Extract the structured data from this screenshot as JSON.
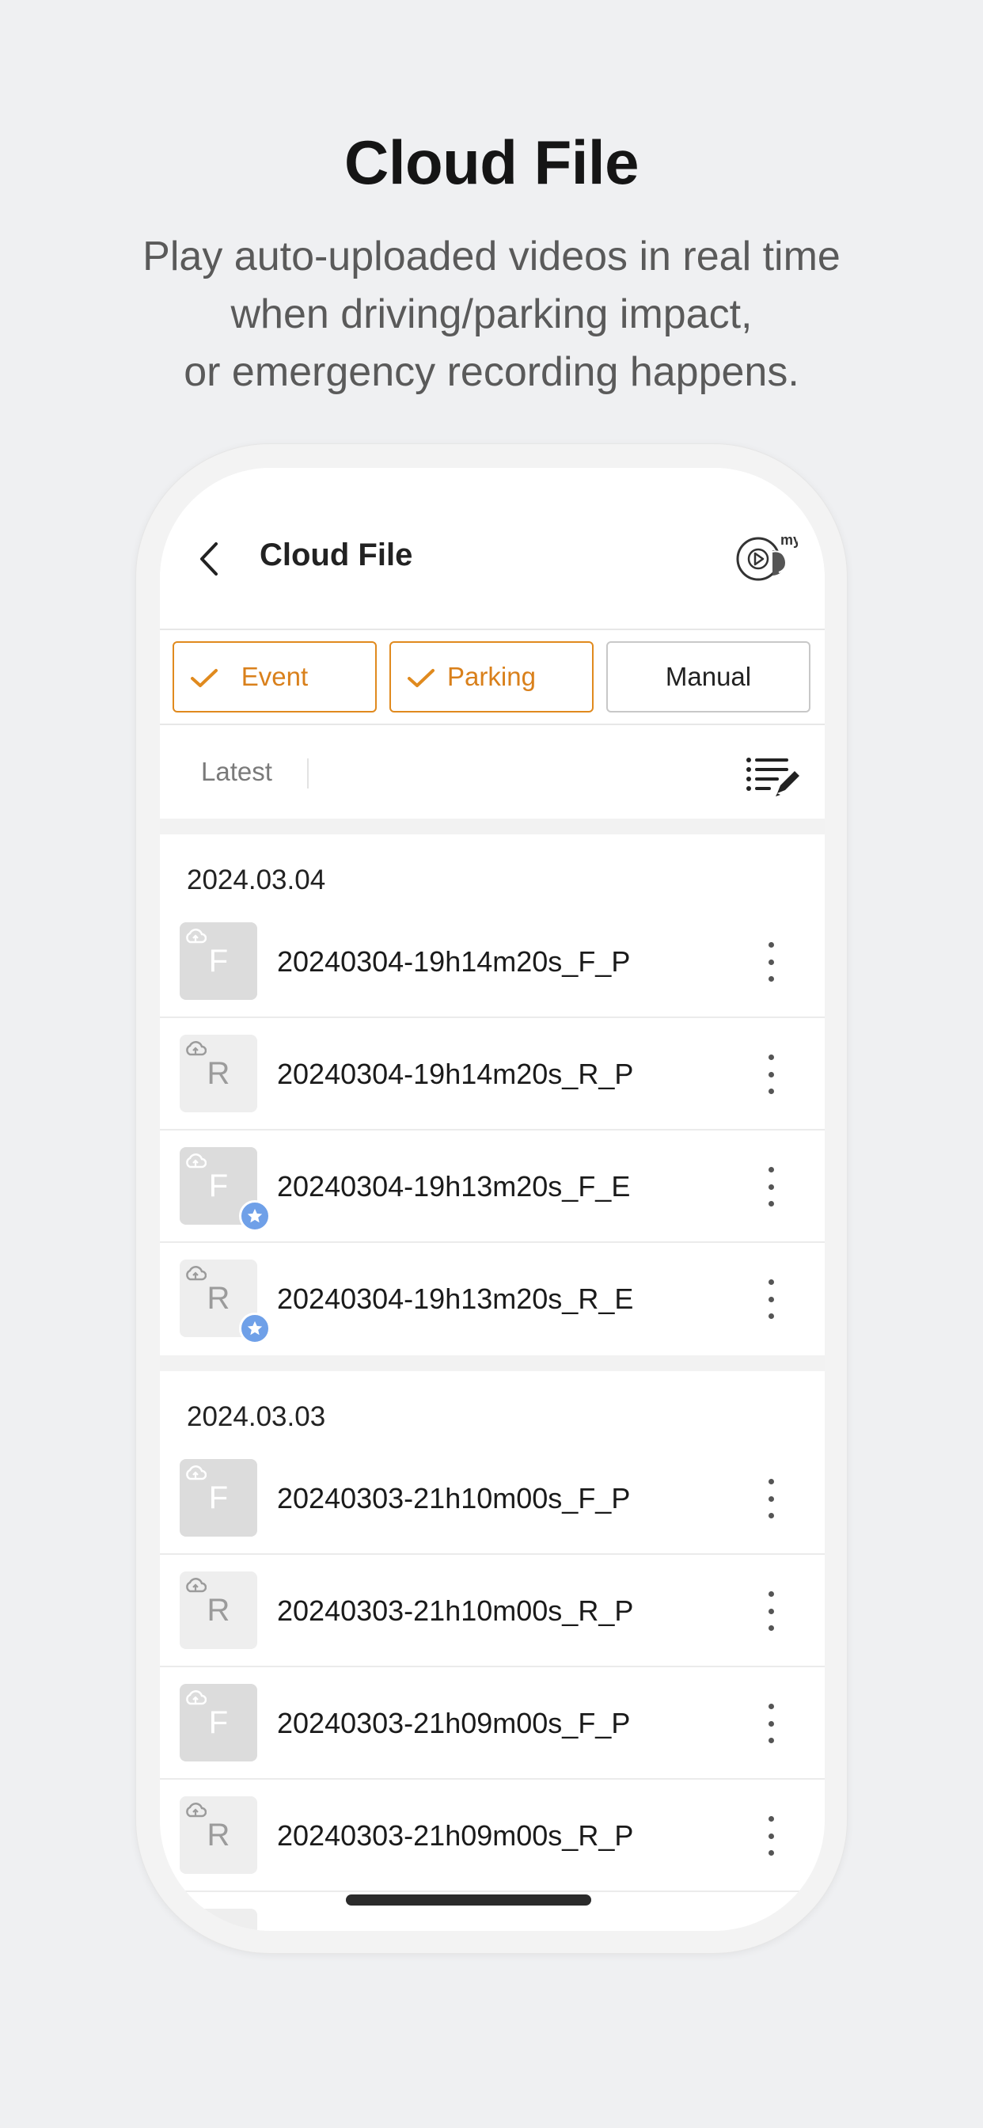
{
  "promo": {
    "title": "Cloud File",
    "subtitle_lines": [
      "Play auto-uploaded videos in real time",
      "when driving/parking impact,",
      "or emergency recording happens."
    ]
  },
  "app": {
    "title": "Cloud File",
    "back_icon": "chevron-left-icon",
    "logo_badge": "my"
  },
  "filters": [
    {
      "label": "Event",
      "selected": true
    },
    {
      "label": "Parking",
      "selected": true
    },
    {
      "label": "Manual",
      "selected": false
    }
  ],
  "sort": {
    "label": "Latest"
  },
  "colors": {
    "accent": "#e08a1e",
    "star": "#6fa0e8"
  },
  "groups": [
    {
      "date": "2024.03.04",
      "files": [
        {
          "thumb": "F",
          "name": "20240304-19h14m20s_F_P",
          "starred": false
        },
        {
          "thumb": "R",
          "name": "20240304-19h14m20s_R_P",
          "starred": false
        },
        {
          "thumb": "F",
          "name": "20240304-19h13m20s_F_E",
          "starred": true
        },
        {
          "thumb": "R",
          "name": "20240304-19h13m20s_R_E",
          "starred": true
        }
      ]
    },
    {
      "date": "2024.03.03",
      "files": [
        {
          "thumb": "F",
          "name": "20240303-21h10m00s_F_P",
          "starred": false
        },
        {
          "thumb": "R",
          "name": "20240303-21h10m00s_R_P",
          "starred": false
        },
        {
          "thumb": "F",
          "name": "20240303-21h09m00s_F_P",
          "starred": false
        },
        {
          "thumb": "R",
          "name": "20240303-21h09m00s_R_P",
          "starred": false
        }
      ]
    }
  ]
}
